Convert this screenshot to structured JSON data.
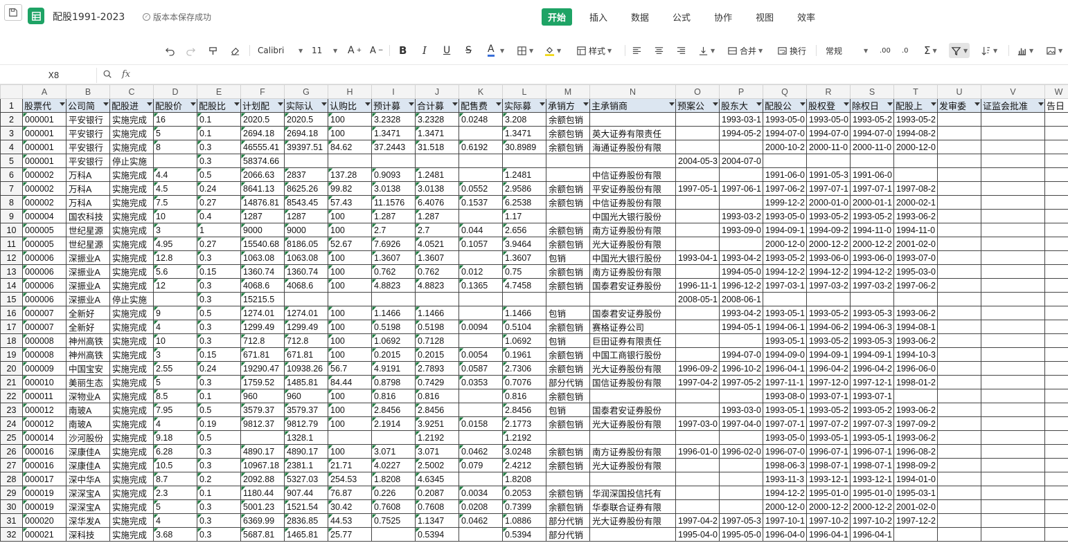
{
  "app": {
    "doc_title": "配股1991-2023",
    "save_status": "版本本保存成功"
  },
  "menu": [
    "开始",
    "插入",
    "数据",
    "公式",
    "协作",
    "视图",
    "效率"
  ],
  "toolbar": {
    "font_name": "Calibri",
    "font_size": "11",
    "style_label": "样式",
    "merge_label": "合并",
    "wrap_label": "换行",
    "format_label": "常规"
  },
  "formula_bar": {
    "cell_ref": "X8",
    "formula": ""
  },
  "columns": [
    "A",
    "B",
    "C",
    "D",
    "E",
    "F",
    "G",
    "H",
    "I",
    "J",
    "K",
    "L",
    "M",
    "N",
    "O",
    "P",
    "Q",
    "R",
    "S",
    "T",
    "U",
    "V",
    "W"
  ],
  "headers": [
    "股票代",
    "公司简",
    "配股进",
    "配股价",
    "配股比",
    "计划配",
    "实际认",
    "认购比",
    "预计募",
    "合计募",
    "配售费",
    "实际募",
    "承销方",
    "主承销商",
    "预案公",
    "股东大",
    "配股公",
    "股权登",
    "除权日",
    "配股上",
    "发审委",
    "证监会批准",
    "告日"
  ],
  "rows": [
    [
      "000001",
      "平安银行",
      "实施完成",
      "16",
      "0.1",
      "2020.5",
      "2020.5",
      "100",
      "3.2328",
      "3.2328",
      "0.0248",
      "3.208",
      "余额包销",
      "",
      "",
      "1993-03-1",
      "1993-05-0",
      "1993-05-0",
      "1993-05-2",
      "1993-05-2",
      "",
      "",
      ""
    ],
    [
      "000001",
      "平安银行",
      "实施完成",
      "5",
      "0.1",
      "2694.18",
      "2694.18",
      "100",
      "1.3471",
      "1.3471",
      "",
      "1.3471",
      "余额包销",
      "英大证券有限责任",
      "",
      "1994-05-2",
      "1994-07-0",
      "1994-07-0",
      "1994-07-0",
      "1994-08-2",
      "",
      "",
      ""
    ],
    [
      "000001",
      "平安银行",
      "实施完成",
      "8",
      "0.3",
      "46555.41",
      "39397.51",
      "84.62",
      "37.2443",
      "31.518",
      "0.6192",
      "30.8989",
      "余额包销",
      "海通证券股份有限",
      "",
      "",
      "2000-10-2",
      "2000-11-0",
      "2000-11-0",
      "2000-12-0",
      "",
      "",
      ""
    ],
    [
      "000001",
      "平安银行",
      "停止实施",
      "",
      "0.3",
      "58374.66",
      "",
      "",
      "",
      "",
      "",
      "",
      "",
      "",
      "2004-05-3",
      "2004-07-0",
      "",
      "",
      "",
      "",
      "",
      "",
      ""
    ],
    [
      "000002",
      "万科A",
      "实施完成",
      "4.4",
      "0.5",
      "2066.63",
      "2837",
      "137.28",
      "0.9093",
      "1.2481",
      "",
      "1.2481",
      "",
      "中信证券股份有限",
      "",
      "",
      "1991-06-0",
      "1991-05-3",
      "1991-06-0",
      "",
      "",
      "",
      ""
    ],
    [
      "000002",
      "万科A",
      "实施完成",
      "4.5",
      "0.24",
      "8641.13",
      "8625.26",
      "99.82",
      "3.0138",
      "3.0138",
      "0.0552",
      "2.9586",
      "余额包销",
      "平安证券股份有限",
      "1997-05-1",
      "1997-06-1",
      "1997-06-2",
      "1997-07-1",
      "1997-07-1",
      "1997-08-2",
      "",
      "",
      ""
    ],
    [
      "000002",
      "万科A",
      "实施完成",
      "7.5",
      "0.27",
      "14876.81",
      "8543.45",
      "57.43",
      "11.1576",
      "6.4076",
      "0.1537",
      "6.2538",
      "余额包销",
      "中信证券股份有限",
      "",
      "",
      "1999-12-2",
      "2000-01-0",
      "2000-01-1",
      "2000-02-1",
      "",
      "",
      ""
    ],
    [
      "000004",
      "国农科技",
      "实施完成",
      "10",
      "0.4",
      "1287",
      "1287",
      "100",
      "1.287",
      "1.287",
      "",
      "1.17",
      "",
      "中国光大银行股份",
      "",
      "1993-03-2",
      "1993-05-0",
      "1993-05-2",
      "1993-05-2",
      "1993-06-2",
      "",
      "",
      ""
    ],
    [
      "000005",
      "世纪星源",
      "实施完成",
      "3",
      "1",
      "9000",
      "9000",
      "100",
      "2.7",
      "2.7",
      "0.044",
      "2.656",
      "余额包销",
      "南方证券股份有限",
      "",
      "1993-09-0",
      "1994-09-1",
      "1994-09-2",
      "1994-11-0",
      "1994-11-0",
      "",
      "",
      ""
    ],
    [
      "000005",
      "世纪星源",
      "实施完成",
      "4.95",
      "0.27",
      "15540.68",
      "8186.05",
      "52.67",
      "7.6926",
      "4.0521",
      "0.1057",
      "3.9464",
      "余额包销",
      "光大证券股份有限",
      "",
      "",
      "2000-12-0",
      "2000-12-2",
      "2000-12-2",
      "2001-02-0",
      "",
      "",
      ""
    ],
    [
      "000006",
      "深振业A",
      "实施完成",
      "12.8",
      "0.3",
      "1063.08",
      "1063.08",
      "100",
      "1.3607",
      "1.3607",
      "",
      "1.3607",
      "包销",
      "中国光大银行股份",
      "1993-04-1",
      "1993-04-2",
      "1993-05-2",
      "1993-06-0",
      "1993-06-0",
      "1993-07-0",
      "",
      "",
      ""
    ],
    [
      "000006",
      "深振业A",
      "实施完成",
      "5.6",
      "0.15",
      "1360.74",
      "1360.74",
      "100",
      "0.762",
      "0.762",
      "0.012",
      "0.75",
      "余额包销",
      "南方证券股份有限",
      "",
      "1994-05-0",
      "1994-12-2",
      "1994-12-2",
      "1994-12-2",
      "1995-03-0",
      "",
      "",
      ""
    ],
    [
      "000006",
      "深振业A",
      "实施完成",
      "12",
      "0.3",
      "4068.6",
      "4068.6",
      "100",
      "4.8823",
      "4.8823",
      "0.1365",
      "4.7458",
      "余额包销",
      "国泰君安证券股份",
      "1996-11-1",
      "1996-12-2",
      "1997-03-1",
      "1997-03-2",
      "1997-03-2",
      "1997-06-2",
      "",
      "",
      ""
    ],
    [
      "000006",
      "深振业A",
      "停止实施",
      "",
      "0.3",
      "15215.5",
      "",
      "",
      "",
      "",
      "",
      "",
      "",
      "",
      "2008-05-1",
      "2008-06-1",
      "",
      "",
      "",
      "",
      "",
      "",
      ""
    ],
    [
      "000007",
      "全新好",
      "实施完成",
      "9",
      "0.5",
      "1274.01",
      "1274.01",
      "100",
      "1.1466",
      "1.1466",
      "",
      "1.1466",
      "包销",
      "国泰君安证券股份",
      "",
      "1993-04-2",
      "1993-05-1",
      "1993-05-2",
      "1993-05-3",
      "1993-06-2",
      "",
      "",
      ""
    ],
    [
      "000007",
      "全新好",
      "实施完成",
      "4",
      "0.3",
      "1299.49",
      "1299.49",
      "100",
      "0.5198",
      "0.5198",
      "0.0094",
      "0.5104",
      "余额包销",
      "赛格证券公司",
      "",
      "1994-05-1",
      "1994-06-1",
      "1994-06-2",
      "1994-06-3",
      "1994-08-1",
      "",
      "",
      ""
    ],
    [
      "000008",
      "神州高铁",
      "实施完成",
      "10",
      "0.3",
      "712.8",
      "712.8",
      "100",
      "1.0692",
      "0.7128",
      "",
      "1.0692",
      "包销",
      "巨田证券有限责任",
      "",
      "",
      "1993-05-1",
      "1993-05-2",
      "1993-05-3",
      "1993-06-2",
      "",
      "",
      ""
    ],
    [
      "000008",
      "神州高铁",
      "实施完成",
      "3",
      "0.15",
      "671.81",
      "671.81",
      "100",
      "0.2015",
      "0.2015",
      "0.0054",
      "0.1961",
      "余额包销",
      "中国工商银行股份",
      "",
      "1994-07-0",
      "1994-09-0",
      "1994-09-1",
      "1994-09-1",
      "1994-10-3",
      "",
      "",
      ""
    ],
    [
      "000009",
      "中国宝安",
      "实施完成",
      "2.55",
      "0.24",
      "19290.47",
      "10938.26",
      "56.7",
      "4.9191",
      "2.7893",
      "0.0587",
      "2.7306",
      "余额包销",
      "光大证券股份有限",
      "1996-09-2",
      "1996-10-2",
      "1996-04-1",
      "1996-04-2",
      "1996-04-2",
      "1996-06-0",
      "",
      "",
      ""
    ],
    [
      "000010",
      "美丽生态",
      "实施完成",
      "5",
      "0.3",
      "1759.52",
      "1485.81",
      "84.44",
      "0.8798",
      "0.7429",
      "0.0353",
      "0.7076",
      "部分代销",
      "国信证券股份有限",
      "1997-04-2",
      "1997-05-2",
      "1997-11-1",
      "1997-12-0",
      "1997-12-1",
      "1998-01-2",
      "",
      "",
      ""
    ],
    [
      "000011",
      "深物业A",
      "实施完成",
      "8.5",
      "0.1",
      "960",
      "960",
      "100",
      "0.816",
      "0.816",
      "",
      "0.816",
      "余额包销",
      "",
      "",
      "",
      "1993-08-0",
      "1993-07-1",
      "1993-07-1",
      "",
      "",
      "",
      ""
    ],
    [
      "000012",
      "南玻A",
      "实施完成",
      "7.95",
      "0.5",
      "3579.37",
      "3579.37",
      "100",
      "2.8456",
      "2.8456",
      "",
      "2.8456",
      "包销",
      "国泰君安证券股份",
      "",
      "1993-03-0",
      "1993-05-1",
      "1993-05-2",
      "1993-05-2",
      "1993-06-2",
      "",
      "",
      ""
    ],
    [
      "000012",
      "南玻A",
      "实施完成",
      "4",
      "0.19",
      "9812.37",
      "9812.79",
      "100",
      "2.1914",
      "3.9251",
      "0.0158",
      "2.1773",
      "余额包销",
      "光大证券股份有限",
      "1997-03-0",
      "1997-04-0",
      "1997-07-1",
      "1997-07-2",
      "1997-07-3",
      "1997-09-2",
      "",
      "",
      ""
    ],
    [
      "000014",
      "沙河股份",
      "实施完成",
      "9.18",
      "0.5",
      "",
      "1328.1",
      "",
      "",
      "1.2192",
      "",
      "1.2192",
      "",
      "",
      "",
      "",
      "1993-05-0",
      "1993-05-1",
      "1993-05-1",
      "1993-06-2",
      "",
      "",
      ""
    ],
    [
      "000016",
      "深康佳A",
      "实施完成",
      "6.28",
      "0.3",
      "4890.17",
      "4890.17",
      "100",
      "3.071",
      "3.071",
      "0.0462",
      "3.0248",
      "余额包销",
      "南方证券股份有限",
      "1996-01-0",
      "1996-02-0",
      "1996-07-0",
      "1996-07-1",
      "1996-07-1",
      "1996-08-2",
      "",
      "",
      ""
    ],
    [
      "000016",
      "深康佳A",
      "实施完成",
      "10.5",
      "0.3",
      "10967.18",
      "2381.1",
      "21.71",
      "4.0227",
      "2.5002",
      "0.079",
      "2.4212",
      "余额包销",
      "光大证券股份有限",
      "",
      "",
      "1998-06-3",
      "1998-07-1",
      "1998-07-1",
      "1998-09-2",
      "",
      "",
      ""
    ],
    [
      "000017",
      "深中华A",
      "实施完成",
      "8.7",
      "0.2",
      "2092.88",
      "5327.03",
      "254.53",
      "1.8208",
      "4.6345",
      "",
      "1.8208",
      "",
      "",
      "",
      "",
      "1993-11-3",
      "1993-12-1",
      "1993-12-1",
      "1994-01-0",
      "",
      "",
      ""
    ],
    [
      "000019",
      "深深宝A",
      "实施完成",
      "2.3",
      "0.1",
      "1180.44",
      "907.44",
      "76.87",
      "0.226",
      "0.2087",
      "0.0034",
      "0.2053",
      "余额包销",
      "华润深国投信托有",
      "",
      "",
      "1994-12-2",
      "1995-01-0",
      "1995-01-0",
      "1995-03-1",
      "",
      "",
      ""
    ],
    [
      "000019",
      "深深宝A",
      "实施完成",
      "5",
      "0.3",
      "5001.23",
      "1521.54",
      "30.42",
      "0.7608",
      "0.7608",
      "0.0208",
      "0.7399",
      "余额包销",
      "华泰联合证券有限",
      "",
      "",
      "2000-12-0",
      "2000-12-2",
      "2000-12-2",
      "2001-02-0",
      "",
      "",
      ""
    ],
    [
      "000020",
      "深华发A",
      "实施完成",
      "4",
      "0.3",
      "6369.99",
      "2836.85",
      "44.53",
      "0.7525",
      "1.1347",
      "0.0462",
      "1.0886",
      "部分代销",
      "光大证券股份有限",
      "1997-04-2",
      "1997-05-3",
      "1997-10-1",
      "1997-10-2",
      "1997-10-2",
      "1997-12-2",
      "",
      "",
      ""
    ],
    [
      "000021",
      "深科技",
      "实施完成",
      "3.68",
      "0.3",
      "5687.81",
      "1465.81",
      "25.77",
      "",
      "0.5394",
      "",
      "0.5394",
      "部分代销",
      "",
      "1995-04-0",
      "1995-05-0",
      "1996-04-0",
      "1996-04-1",
      "1996-04-1",
      "",
      "",
      "",
      ""
    ]
  ]
}
